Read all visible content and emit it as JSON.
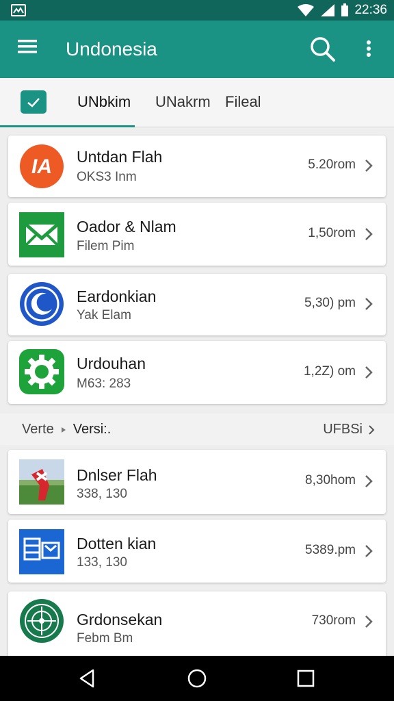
{
  "status_bar": {
    "time": "22:36"
  },
  "app_bar": {
    "title": "Undonesia"
  },
  "tabs": [
    {
      "label": "UNbkim",
      "active": true
    },
    {
      "label": "UNakrm",
      "active": false
    },
    {
      "label": "Fileal",
      "active": false
    }
  ],
  "items": [
    {
      "title": "Untdan Flah",
      "subtitle": "OKS3 Inm",
      "time": "5.20rom",
      "icon": "brand-logo-icon"
    },
    {
      "title": "Oador & Nlam",
      "subtitle": "Filem Pim",
      "time": "1,50rom",
      "icon": "envelope-icon"
    },
    {
      "title": "Eardonkian",
      "subtitle": "Yak Elam",
      "time": "5,30) pm",
      "icon": "moon-icon"
    },
    {
      "title": "Urdouhan",
      "subtitle": "M63: 283",
      "time": "1,2Z) om",
      "icon": "gear-icon"
    }
  ],
  "section": {
    "breadcrumb_parent": "Verte",
    "breadcrumb_current": "Versi:.",
    "right_label": "UFBSi"
  },
  "items2": [
    {
      "title": "Dnlser Flah",
      "subtitle": "338, 130",
      "time": "8,30hom",
      "icon": "photo-icon"
    },
    {
      "title": "Dotten kian",
      "subtitle": "133, 130",
      "time": "5389.pm",
      "icon": "calendar-icon"
    },
    {
      "title": "Grdonsekan",
      "subtitle": "Febm Bm",
      "time": "730rom",
      "icon": "compass-icon"
    }
  ],
  "colors": {
    "primary": "#1b9384",
    "status_bar": "#11665c",
    "accent": "#1b9384"
  }
}
